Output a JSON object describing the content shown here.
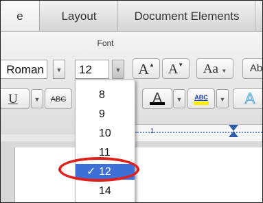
{
  "tabs": {
    "home": "e",
    "layout": "Layout",
    "document_elements": "Document Elements"
  },
  "ribbon": {
    "group_label": "Font",
    "font_name": "Roman",
    "font_size": "12",
    "grow_font_label": "A",
    "shrink_font_label": "A",
    "change_case_label": "Aa",
    "clear_formatting_label": "Ab",
    "underline_label": "U",
    "strikethrough_label": "ABC",
    "font_color_label": "A",
    "highlight_label": "ABC",
    "text_effects_label": "A"
  },
  "font_size_list": {
    "options": [
      "8",
      "9",
      "10",
      "11",
      "12",
      "14"
    ],
    "selected": "12",
    "check_mark": "✓"
  },
  "colors": {
    "selection": "#3d6fd6",
    "callout": "#e0201a",
    "font_color_bar": "#000000",
    "highlight_bar": "#ffee00"
  }
}
